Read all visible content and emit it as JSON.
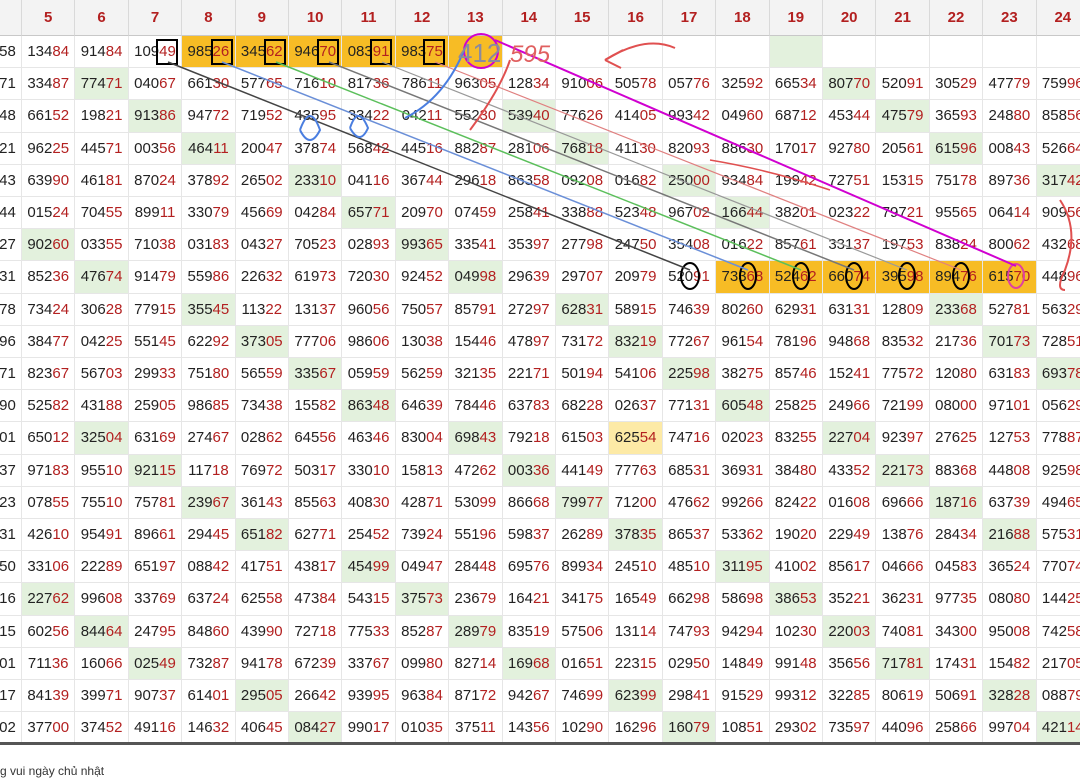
{
  "headers": [
    "5",
    "6",
    "7",
    "8",
    "9",
    "10",
    "11",
    "12",
    "13",
    "14",
    "15",
    "16",
    "17",
    "18",
    "19",
    "20",
    "21",
    "22",
    "23",
    "24"
  ],
  "row_labels": [
    "58",
    "71",
    "48",
    "21",
    "43",
    "44",
    "27",
    "31",
    "78",
    "96",
    "71",
    "90",
    "01",
    "37",
    "23",
    "31",
    "50",
    "16",
    "15",
    "01",
    "17",
    "02"
  ],
  "rows": [
    [
      "13484",
      "91484",
      "10949",
      "98526",
      "34562",
      "94670",
      "08391",
      "98375",
      "",
      "",
      "",
      "",
      "",
      "",
      "",
      "",
      "",
      "",
      "",
      ""
    ],
    [
      "33487",
      "77471",
      "04067",
      "66130",
      "57765",
      "71610",
      "81736",
      "78611",
      "96305",
      "12834",
      "91006",
      "50578",
      "05776",
      "32592",
      "66534",
      "80770",
      "52091",
      "30529",
      "47779",
      "75996"
    ],
    [
      "66152",
      "19821",
      "91386",
      "94772",
      "71952",
      "43595",
      "33422",
      "04211",
      "55230",
      "53940",
      "77626",
      "41405",
      "99342",
      "04960",
      "68712",
      "45344",
      "47579",
      "36593",
      "24880",
      "85856"
    ],
    [
      "96225",
      "44571",
      "00356",
      "46411",
      "20047",
      "37874",
      "56842",
      "44516",
      "88287",
      "28106",
      "76818",
      "41130",
      "82093",
      "88630",
      "17017",
      "92780",
      "20561",
      "61596",
      "00843",
      "52664"
    ],
    [
      "63990",
      "46181",
      "87024",
      "37892",
      "26502",
      "23310",
      "04116",
      "36744",
      "29618",
      "86358",
      "09208",
      "01682",
      "25000",
      "93484",
      "19942",
      "72751",
      "15315",
      "75178",
      "89736",
      "31742"
    ],
    [
      "01524",
      "70455",
      "89911",
      "33079",
      "45669",
      "04284",
      "65771",
      "20970",
      "07459",
      "25841",
      "33888",
      "52348",
      "96702",
      "16644",
      "38201",
      "02322",
      "79721",
      "95565",
      "06414",
      "90956"
    ],
    [
      "90260",
      "03355",
      "71038",
      "03183",
      "04327",
      "70523",
      "02893",
      "99365",
      "33541",
      "35397",
      "27798",
      "24750",
      "35408",
      "01622",
      "85761",
      "33137",
      "19753",
      "83824",
      "80062",
      "43268"
    ],
    [
      "85236",
      "47674",
      "91479",
      "55986",
      "22632",
      "61973",
      "72030",
      "92452",
      "04998",
      "29639",
      "29707",
      "20979",
      "52091",
      "73368",
      "52462",
      "66074",
      "39598",
      "89476",
      "61570",
      "44896"
    ],
    [
      "73424",
      "30628",
      "77915",
      "35545",
      "11322",
      "13137",
      "96056",
      "75057",
      "85791",
      "27297",
      "62831",
      "58915",
      "74639",
      "80260",
      "62931",
      "63131",
      "12809",
      "23368",
      "52781",
      "56329"
    ],
    [
      "38477",
      "04225",
      "55145",
      "62292",
      "37305",
      "77706",
      "98606",
      "13038",
      "15446",
      "47897",
      "73172",
      "83219",
      "77267",
      "96154",
      "78196",
      "94868",
      "83532",
      "21736",
      "70173",
      "72851"
    ],
    [
      "82367",
      "56703",
      "29933",
      "75180",
      "56559",
      "33567",
      "05959",
      "56259",
      "32135",
      "22171",
      "50194",
      "54106",
      "22598",
      "38275",
      "85746",
      "15241",
      "77572",
      "12080",
      "63183",
      "69378"
    ],
    [
      "52582",
      "43188",
      "25905",
      "98685",
      "73438",
      "15582",
      "86348",
      "64639",
      "78446",
      "63783",
      "68228",
      "02637",
      "77131",
      "60548",
      "25825",
      "24966",
      "72199",
      "08000",
      "97101",
      "05629"
    ],
    [
      "65012",
      "32504",
      "63169",
      "27467",
      "02862",
      "64556",
      "46346",
      "83004",
      "69843",
      "79218",
      "61503",
      "62554",
      "74716",
      "02023",
      "83255",
      "22704",
      "92397",
      "27625",
      "12753",
      "77887"
    ],
    [
      "97183",
      "95510",
      "92115",
      "11718",
      "76972",
      "50317",
      "33010",
      "15813",
      "47262",
      "00336",
      "44149",
      "77763",
      "68531",
      "36931",
      "38480",
      "43352",
      "22173",
      "88368",
      "44808",
      "92598"
    ],
    [
      "07855",
      "75510",
      "75781",
      "23967",
      "36143",
      "85563",
      "40830",
      "42871",
      "53099",
      "86668",
      "79977",
      "71200",
      "47662",
      "99266",
      "82422",
      "01608",
      "69666",
      "18716",
      "63739",
      "49465"
    ],
    [
      "42610",
      "95491",
      "89661",
      "29445",
      "65182",
      "62771",
      "25452",
      "73924",
      "55196",
      "59837",
      "26289",
      "37835",
      "86537",
      "53362",
      "19020",
      "22949",
      "13876",
      "28434",
      "21688",
      "57531"
    ],
    [
      "33106",
      "22289",
      "65197",
      "08842",
      "41751",
      "43817",
      "45499",
      "04947",
      "28448",
      "69576",
      "89934",
      "24510",
      "48510",
      "31195",
      "41002",
      "85617",
      "04666",
      "04583",
      "36524",
      "77074"
    ],
    [
      "22762",
      "99608",
      "33769",
      "63724",
      "62558",
      "47384",
      "54315",
      "37573",
      "23679",
      "16421",
      "34175",
      "16549",
      "66298",
      "58698",
      "38653",
      "35221",
      "36231",
      "97735",
      "08080",
      "14425"
    ],
    [
      "60256",
      "84464",
      "24795",
      "84860",
      "43990",
      "72718",
      "77533",
      "85287",
      "28979",
      "83519",
      "57506",
      "13114",
      "74793",
      "94294",
      "10230",
      "22003",
      "74081",
      "34300",
      "95008",
      "74258"
    ],
    [
      "71136",
      "16066",
      "02549",
      "73287",
      "94178",
      "67239",
      "33767",
      "09980",
      "82714",
      "16968",
      "01651",
      "22315",
      "02950",
      "14849",
      "99148",
      "35656",
      "71781",
      "17431",
      "15482",
      "21705"
    ],
    [
      "84139",
      "39971",
      "90737",
      "61401",
      "29505",
      "26642",
      "93995",
      "96384",
      "87172",
      "94267",
      "74699",
      "62399",
      "29841",
      "91529",
      "99312",
      "32285",
      "80619",
      "50691",
      "32828",
      "08879"
    ],
    [
      "37700",
      "37452",
      "49116",
      "14632",
      "40645",
      "08427",
      "99017",
      "01035",
      "37511",
      "14356",
      "10290",
      "16296",
      "16079",
      "10851",
      "29302",
      "73597",
      "44096",
      "25866",
      "99704",
      "42114"
    ]
  ],
  "annotations": {
    "handwritten_a": "412",
    "handwritten_b": "595"
  },
  "footer_text": "g vui ngày chủ nhật"
}
